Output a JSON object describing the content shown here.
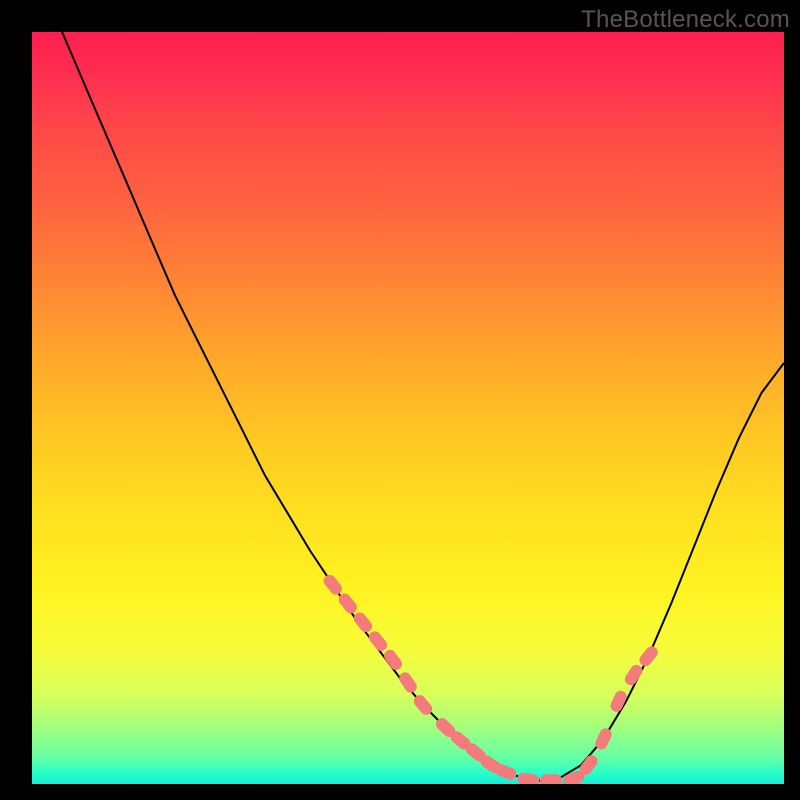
{
  "watermark": "TheBottleneck.com",
  "colors": {
    "marker": "#f37b7b",
    "curve": "#000000",
    "background": "#000000"
  },
  "chart_data": {
    "type": "line",
    "title": "",
    "xlabel": "",
    "ylabel": "",
    "xlim": [
      0,
      100
    ],
    "ylim": [
      0,
      100
    ],
    "x": [
      4,
      7,
      10,
      13,
      16,
      19,
      22,
      25,
      28,
      31,
      34,
      37,
      40,
      43,
      46,
      49,
      52,
      55,
      58,
      61,
      64,
      67,
      70,
      73,
      76,
      79,
      82,
      85,
      88,
      91,
      94,
      97,
      100
    ],
    "y": [
      100,
      93,
      86,
      79,
      72,
      65,
      59,
      53,
      47,
      41,
      36,
      31,
      26.5,
      22,
      18,
      14,
      10.5,
      7.5,
      4.8,
      2.6,
      1.2,
      0.4,
      0.7,
      2.5,
      6,
      11,
      17,
      24,
      31.5,
      39,
      46,
      52,
      56
    ],
    "markers": {
      "x": [
        40,
        42,
        44,
        46,
        48,
        50,
        52,
        55,
        57,
        59,
        61,
        63,
        66,
        69,
        72,
        74,
        76,
        78,
        80,
        82
      ],
      "y": [
        26.5,
        24,
        21.5,
        19,
        16.5,
        13.5,
        10.5,
        7.5,
        5.8,
        4.2,
        2.6,
        1.6,
        0.6,
        0.5,
        0.7,
        2.5,
        6,
        11,
        14.5,
        17
      ]
    }
  }
}
